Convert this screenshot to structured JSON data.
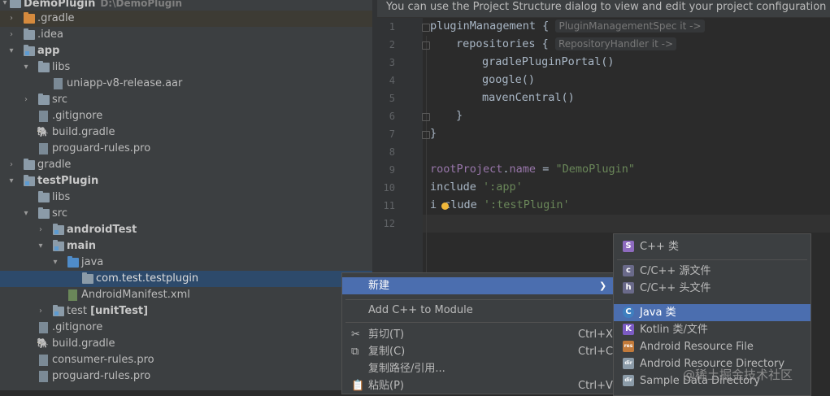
{
  "tree": {
    "root": {
      "label": "DemoPlugin",
      "path": "D:\\DemoPlugin"
    },
    "items": [
      {
        "label": ".gradle"
      },
      {
        "label": ".idea"
      },
      {
        "label": "app"
      },
      {
        "label": "libs"
      },
      {
        "label": "uniapp-v8-release.aar"
      },
      {
        "label": "src"
      },
      {
        "label": ".gitignore"
      },
      {
        "label": "build.gradle"
      },
      {
        "label": "proguard-rules.pro"
      },
      {
        "label": "gradle"
      },
      {
        "label": "testPlugin"
      },
      {
        "label": "libs"
      },
      {
        "label": "src"
      },
      {
        "label": "androidTest"
      },
      {
        "label": "main"
      },
      {
        "label": "java"
      },
      {
        "label": "com.test.testplugin"
      },
      {
        "label": "AndroidManifest.xml"
      },
      {
        "label": "test",
        "extra": "[unitTest]"
      },
      {
        "label": ".gitignore"
      },
      {
        "label": "build.gradle"
      },
      {
        "label": "consumer-rules.pro"
      },
      {
        "label": "proguard-rules.pro"
      }
    ]
  },
  "editor": {
    "banner": "You can use the Project Structure dialog to view and edit your project configuration",
    "line_numbers": [
      "1",
      "2",
      "3",
      "4",
      "5",
      "6",
      "7",
      "8",
      "9",
      "10",
      "11",
      "12"
    ],
    "hints": [
      "PluginManagementSpec it ->",
      "RepositoryHandler it ->"
    ],
    "code": {
      "l1": "pluginManagement {",
      "l2": "repositories {",
      "l3": "gradlePluginPortal()",
      "l4": "google()",
      "l5": "mavenCentral()",
      "l6": "}",
      "l7": "}",
      "l9a": "rootProject",
      "l9b": ".",
      "l9c": "name",
      "l9d": " = ",
      "l9e": "\"DemoPlugin\"",
      "l10a": "include ",
      "l10b": "':app'",
      "l11a": "i",
      "l11b": "clude ",
      "l11c": "':testPlugin'"
    }
  },
  "context_menu": {
    "items": [
      {
        "label": "新建",
        "shortcut": ""
      },
      {
        "label": "Add C++ to Module",
        "shortcut": ""
      },
      {
        "label": "剪切(T)",
        "shortcut": "Ctrl+X"
      },
      {
        "label": "复制(C)",
        "shortcut": "Ctrl+C"
      },
      {
        "label": "复制路径/引用...",
        "shortcut": ""
      },
      {
        "label": "粘贴(P)",
        "shortcut": "Ctrl+V"
      }
    ],
    "submenu_arrow": "❯"
  },
  "submenu": {
    "items": [
      {
        "label": "C++ 类",
        "icon": "S"
      },
      {
        "label": "C/C++ 源文件",
        "icon": "c"
      },
      {
        "label": "C/C++ 头文件",
        "icon": "h"
      },
      {
        "label": "Java 类",
        "icon": "C"
      },
      {
        "label": "Kotlin 类/文件",
        "icon": "K"
      },
      {
        "label": "Android Resource File",
        "icon": "res"
      },
      {
        "label": "Android Resource Directory",
        "icon": "dir"
      },
      {
        "label": "Sample Data Directory",
        "icon": "dir"
      }
    ]
  },
  "watermark": "@稀土掘金技术社区",
  "colors": {
    "selection": "#4b6eaf",
    "tree_selection": "#2d4a6b",
    "orange_folder": "#d58a3d"
  }
}
